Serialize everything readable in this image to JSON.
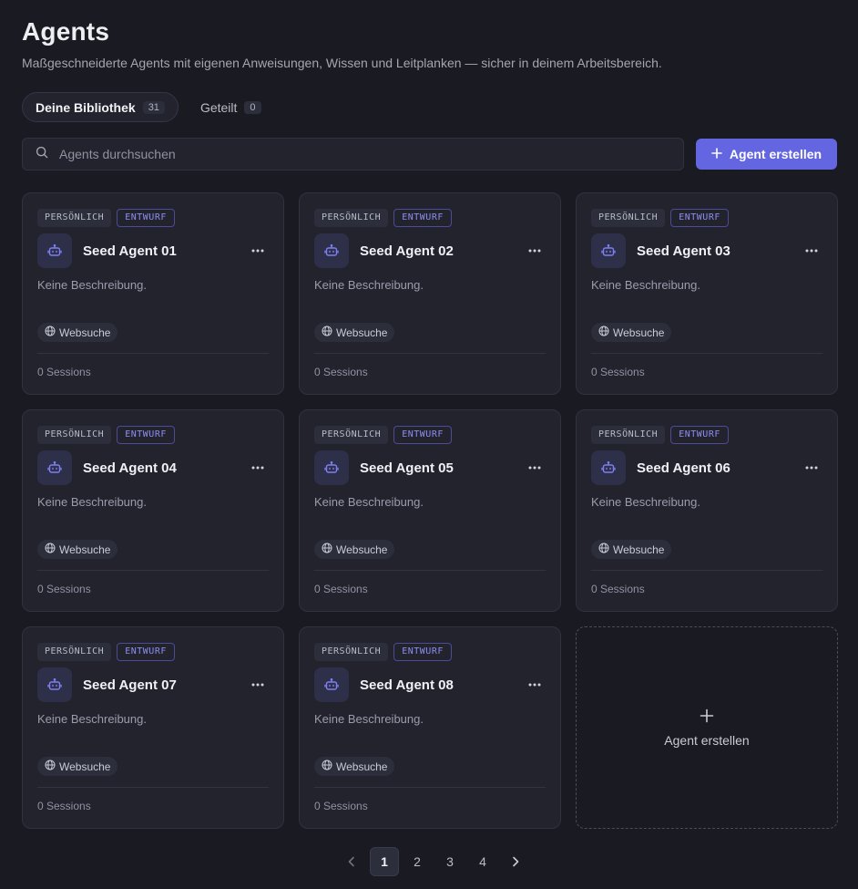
{
  "header": {
    "title": "Agents",
    "subtitle": "Maßgeschneiderte Agents mit eigenen Anweisungen, Wissen und Leitplanken — sicher in deinem Arbeitsbereich."
  },
  "tabs": [
    {
      "label": "Deine Bibliothek",
      "count": "31",
      "active": true
    },
    {
      "label": "Geteilt",
      "count": "0",
      "active": false
    }
  ],
  "search": {
    "placeholder": "Agents durchsuchen",
    "value": ""
  },
  "create_button": {
    "label": "Agent erstellen"
  },
  "cards": [
    {
      "badge_scope": "PERSÖNLICH",
      "badge_status": "ENTWURF",
      "name": "Seed Agent 01",
      "description": "Keine Beschreibung.",
      "tool": "Websuche",
      "sessions": "0 Sessions"
    },
    {
      "badge_scope": "PERSÖNLICH",
      "badge_status": "ENTWURF",
      "name": "Seed Agent 02",
      "description": "Keine Beschreibung.",
      "tool": "Websuche",
      "sessions": "0 Sessions"
    },
    {
      "badge_scope": "PERSÖNLICH",
      "badge_status": "ENTWURF",
      "name": "Seed Agent 03",
      "description": "Keine Beschreibung.",
      "tool": "Websuche",
      "sessions": "0 Sessions"
    },
    {
      "badge_scope": "PERSÖNLICH",
      "badge_status": "ENTWURF",
      "name": "Seed Agent 04",
      "description": "Keine Beschreibung.",
      "tool": "Websuche",
      "sessions": "0 Sessions"
    },
    {
      "badge_scope": "PERSÖNLICH",
      "badge_status": "ENTWURF",
      "name": "Seed Agent 05",
      "description": "Keine Beschreibung.",
      "tool": "Websuche",
      "sessions": "0 Sessions"
    },
    {
      "badge_scope": "PERSÖNLICH",
      "badge_status": "ENTWURF",
      "name": "Seed Agent 06",
      "description": "Keine Beschreibung.",
      "tool": "Websuche",
      "sessions": "0 Sessions"
    },
    {
      "badge_scope": "PERSÖNLICH",
      "badge_status": "ENTWURF",
      "name": "Seed Agent 07",
      "description": "Keine Beschreibung.",
      "tool": "Websuche",
      "sessions": "0 Sessions"
    },
    {
      "badge_scope": "PERSÖNLICH",
      "badge_status": "ENTWURF",
      "name": "Seed Agent 08",
      "description": "Keine Beschreibung.",
      "tool": "Websuche",
      "sessions": "0 Sessions"
    }
  ],
  "add_card": {
    "label": "Agent erstellen"
  },
  "pagination": {
    "pages": [
      "1",
      "2",
      "3",
      "4"
    ],
    "current": "1"
  },
  "icons": {
    "search": "search-icon",
    "plus": "plus-icon",
    "agent": "robot-icon",
    "more": "more-horizontal-icon",
    "tool": "globe-icon",
    "prev": "chevron-left-icon",
    "next": "chevron-right-icon"
  },
  "colors": {
    "background": "#1a1b22",
    "card": "#22232d",
    "accent": "#6366e0",
    "draft_badge": "#8c8ef0"
  }
}
